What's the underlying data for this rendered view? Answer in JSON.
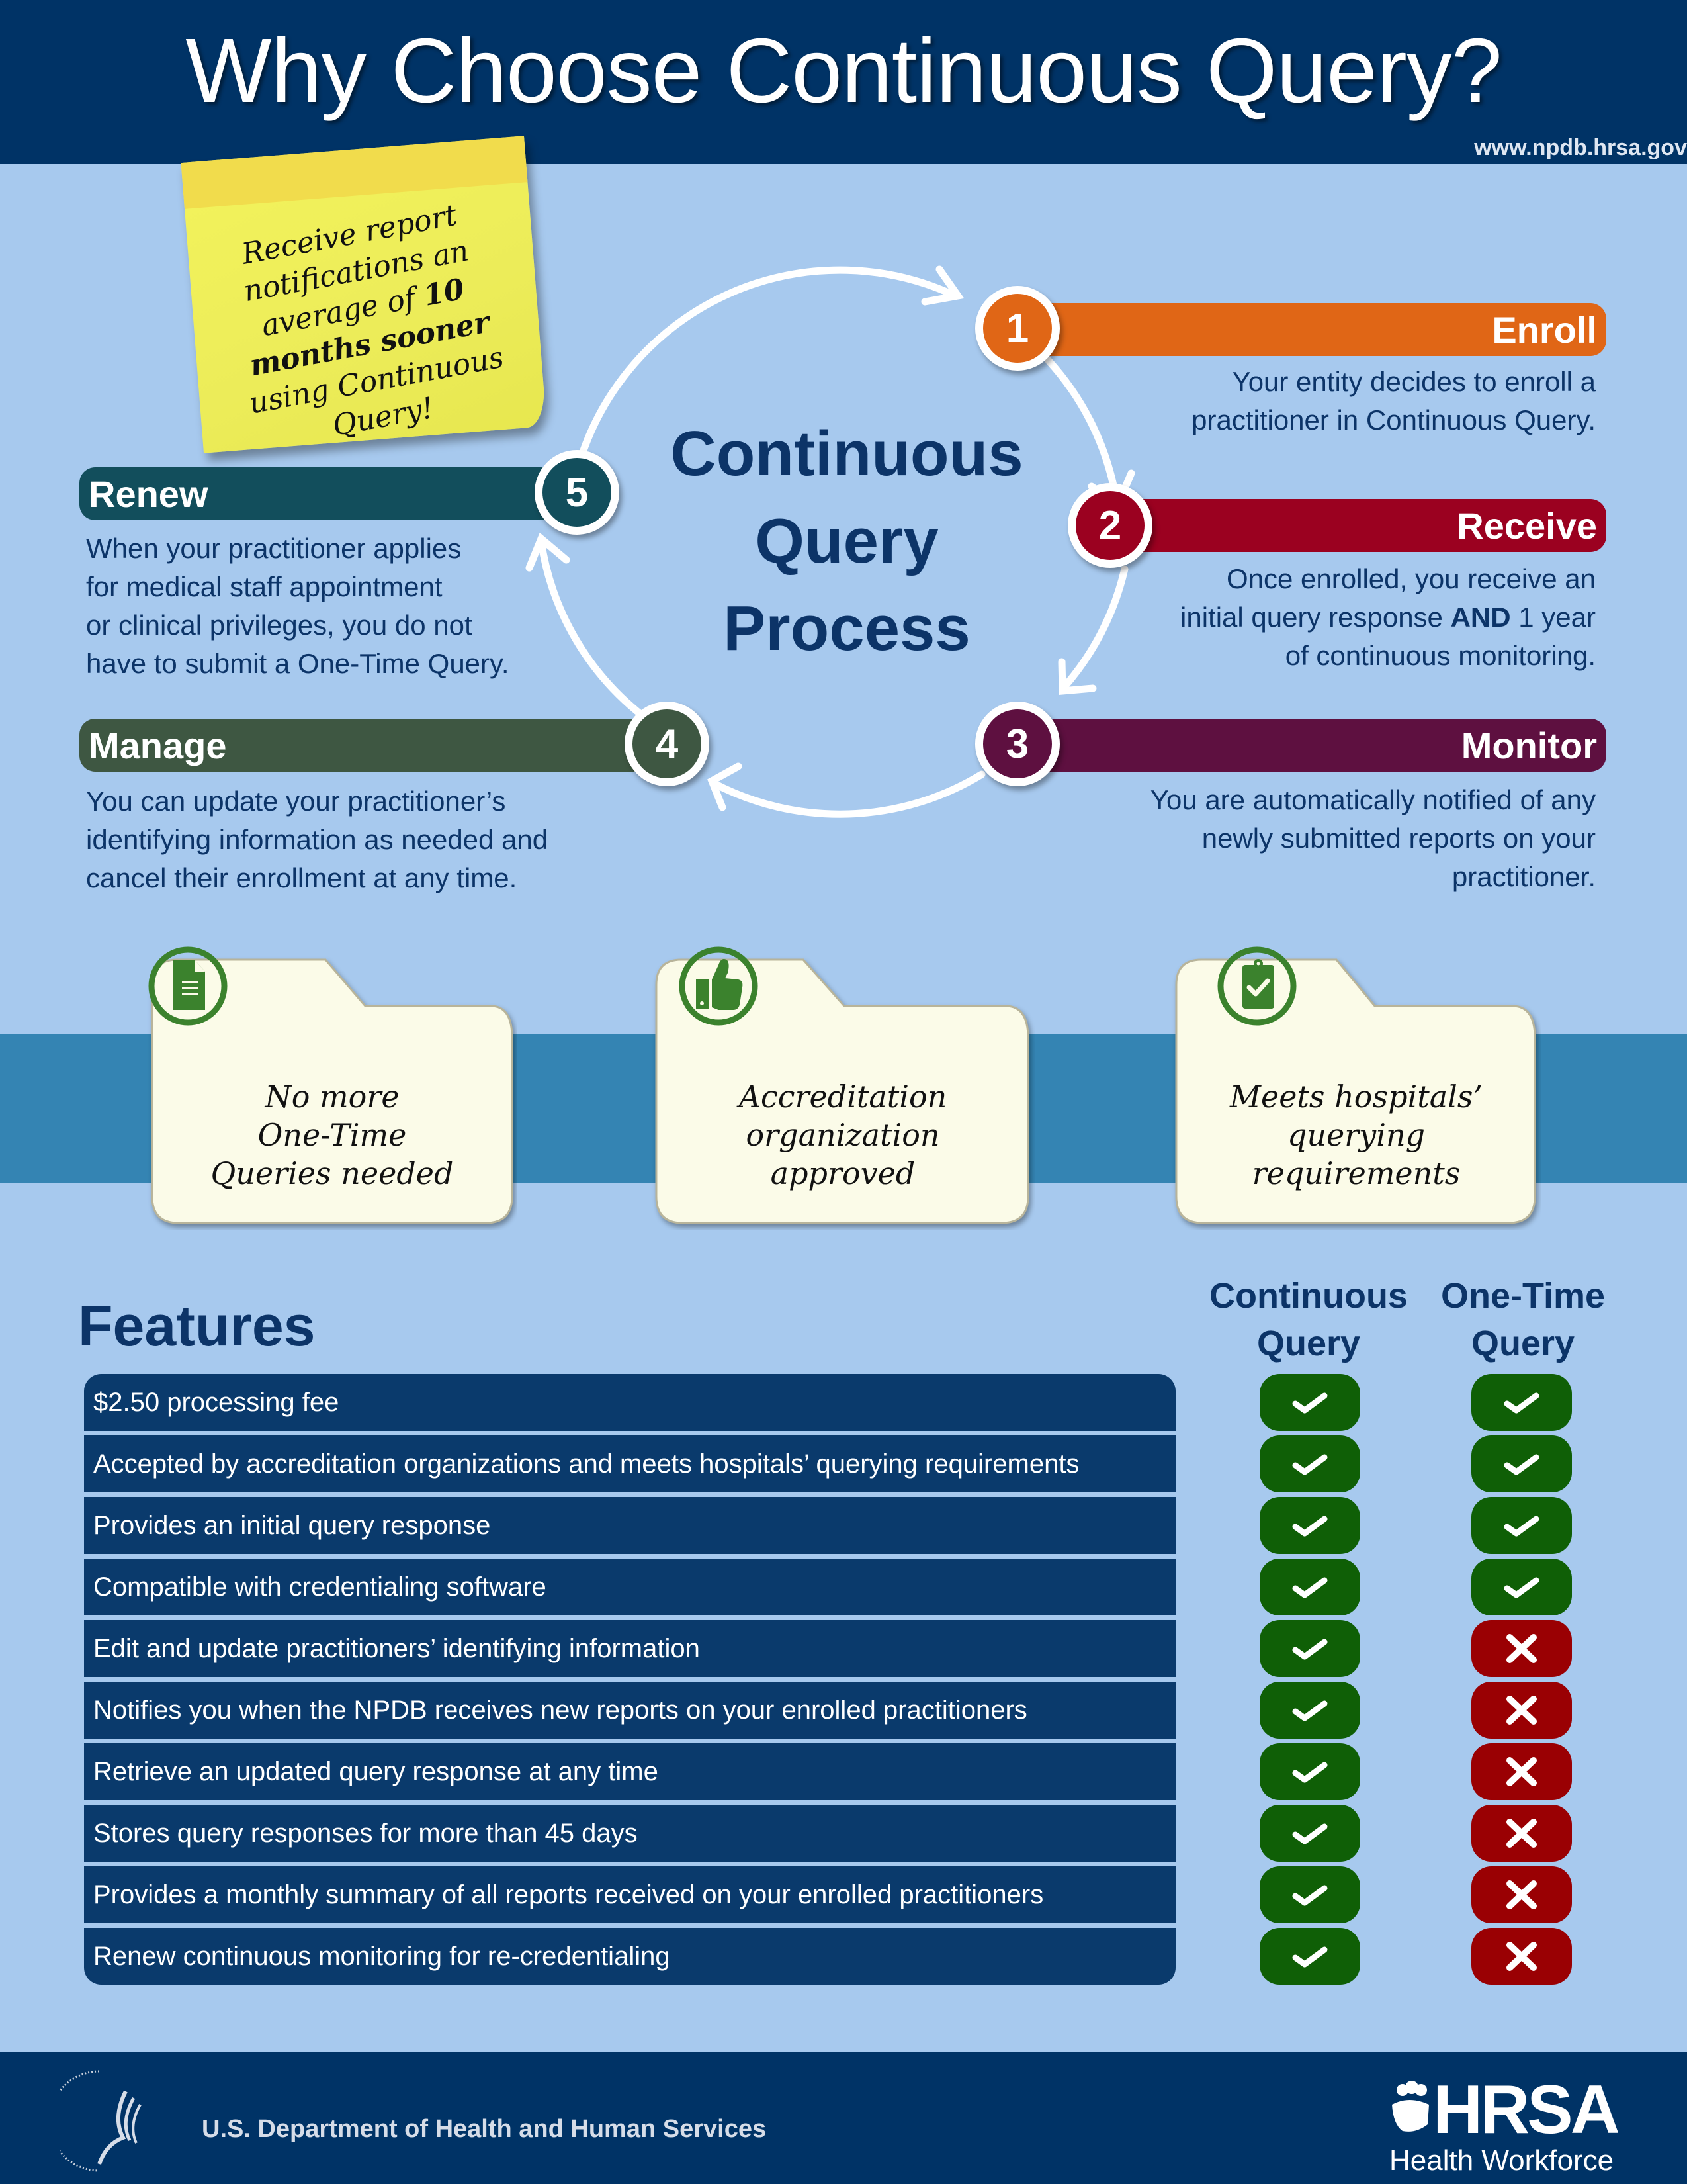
{
  "header": {
    "title": "Why Choose Continuous Query?",
    "url": "www.npdb.hrsa.gov"
  },
  "sticky_note": {
    "line1": "Receive report",
    "line2": "notifications an",
    "line3_pre": "average of ",
    "line3_bold": "10",
    "line4_bold": "months sooner",
    "line5": "using Continuous",
    "line6": "Query!"
  },
  "process": {
    "title_line1": "Continuous",
    "title_line2": "Query",
    "title_line3": "Process",
    "steps": [
      {
        "number": "1",
        "label": "Enroll",
        "color": "#e06616",
        "desc": [
          "Your entity decides to enroll a",
          "practitioner in Continuous Query."
        ]
      },
      {
        "number": "2",
        "label": "Receive",
        "color": "#9b0120",
        "desc_line1": "Once enrolled, you receive an",
        "desc_line2_pre": "initial query response ",
        "desc_line2_bold": "AND",
        "desc_line2_post": " 1 year",
        "desc_line3": "of continuous monitoring."
      },
      {
        "number": "3",
        "label": "Monitor",
        "color": "#5e1040",
        "desc": [
          "You are automatically notified of any",
          "newly submitted reports on your",
          "practitioner."
        ]
      },
      {
        "number": "4",
        "label": "Manage",
        "color": "#3e5742",
        "desc": [
          "You can update your practitioner’s",
          "identifying information as needed and",
          "cancel their enrollment at any time."
        ]
      },
      {
        "number": "5",
        "label": "Renew",
        "color": "#124e5c",
        "desc": [
          "When your practitioner applies",
          "for medical staff appointment",
          "or clinical privileges, you do not",
          "have to submit a One-Time Query."
        ]
      }
    ]
  },
  "benefits": [
    {
      "icon": "document-icon",
      "lines": [
        "No more",
        "One-Time",
        "Queries needed"
      ]
    },
    {
      "icon": "thumbs-up-icon",
      "lines": [
        "Accreditation",
        "organization",
        "approved"
      ]
    },
    {
      "icon": "clipboard-check-icon",
      "lines": [
        "Meets hospitals’",
        "querying",
        "requirements"
      ]
    }
  ],
  "features": {
    "title": "Features",
    "columns": [
      {
        "line1": "Continuous",
        "line2": "Query"
      },
      {
        "line1": "One-Time",
        "line2": "Query"
      }
    ],
    "rows": [
      {
        "label": "$2.50 processing fee",
        "continuous": "yes",
        "one_time": "yes"
      },
      {
        "label": "Accepted by accreditation organizations and meets hospitals’ querying requirements",
        "continuous": "yes",
        "one_time": "yes"
      },
      {
        "label": "Provides an initial query response",
        "continuous": "yes",
        "one_time": "yes"
      },
      {
        "label": "Compatible with credentialing software",
        "continuous": "yes",
        "one_time": "yes"
      },
      {
        "label": "Edit and update practitioners’ identifying information",
        "continuous": "yes",
        "one_time": "no"
      },
      {
        "label": "Notifies you when the NPDB receives new reports on your enrolled practitioners",
        "continuous": "yes",
        "one_time": "no"
      },
      {
        "label": "Retrieve an updated query response at any time",
        "continuous": "yes",
        "one_time": "no"
      },
      {
        "label": "Stores query responses for more than 45 days",
        "continuous": "yes",
        "one_time": "no"
      },
      {
        "label": "Provides a monthly summary of all reports received on your enrolled practitioners",
        "continuous": "yes",
        "one_time": "no"
      },
      {
        "label": "Renew continuous monitoring for re-credentialing",
        "continuous": "yes",
        "one_time": "no"
      }
    ],
    "yes_color": "#0f5f06",
    "no_color": "#9a0003"
  },
  "footer": {
    "hhs_label": "U.S. Department of Health and Human Services",
    "hrsa_logo": "HRSA",
    "hrsa_sub": "Health Workforce"
  }
}
